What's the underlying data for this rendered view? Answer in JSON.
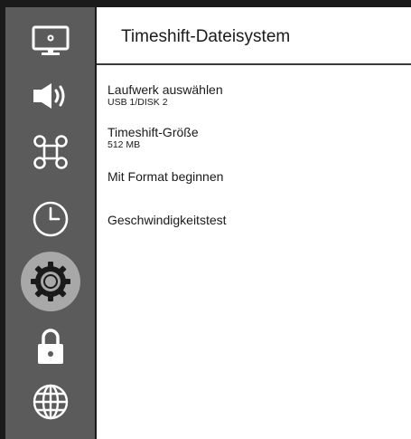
{
  "header": {
    "title": "Timeshift-Dateisystem"
  },
  "sidebar": {
    "items": [
      {
        "icon": "monitor-settings-icon"
      },
      {
        "icon": "speaker-icon"
      },
      {
        "icon": "command-key-icon"
      },
      {
        "icon": "clock-icon"
      },
      {
        "icon": "gear-icon",
        "selected": true
      },
      {
        "icon": "lock-icon"
      },
      {
        "icon": "globe-icon"
      }
    ]
  },
  "menu": {
    "items": [
      {
        "label": "Laufwerk auswählen",
        "value": "USB 1/DISK 2"
      },
      {
        "label": "Timeshift-Größe",
        "value": "512 MB"
      },
      {
        "label": "Mit Format beginnen"
      },
      {
        "label": "Geschwindigkeitstest"
      }
    ]
  },
  "colors": {
    "sidebar_bg": "#5b5b5b",
    "selected_bg": "#a8a8a8",
    "border": "#1a1a1a",
    "text": "#1a1a1a"
  }
}
